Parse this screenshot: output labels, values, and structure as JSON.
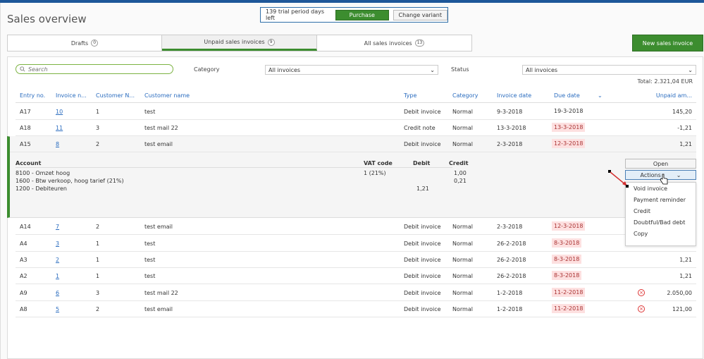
{
  "page": {
    "title": "Sales overview"
  },
  "trial": {
    "text": "139 trial period days left",
    "purchase": "Purchase",
    "change_variant": "Change variant"
  },
  "tabs": [
    {
      "label": "Drafts",
      "count": "0"
    },
    {
      "label": "Unpaid sales invoices",
      "count": "9"
    },
    {
      "label": "All sales invoices",
      "count": "13"
    }
  ],
  "new_button": "New sales invoice",
  "filters": {
    "search_placeholder": "Search",
    "category_label": "Category",
    "category_value": "All invoices",
    "status_label": "Status",
    "status_value": "All invoices"
  },
  "total": "Total: 2.321,04 EUR",
  "columns": {
    "entry": "Entry no.",
    "invoice": "Invoice n...",
    "custno": "Customer N...",
    "custname": "Customer name",
    "type": "Type",
    "category": "Category",
    "invdate": "Invoice date",
    "duedate": "Due date",
    "unpaid": "Unpaid am..."
  },
  "rows": [
    {
      "entry": "A17",
      "invoice": "10",
      "custno": "1",
      "custname": "test",
      "type": "Debit invoice",
      "category": "Normal",
      "invdate": "9-3-2018",
      "duedate": "19-3-2018",
      "late": false,
      "unpaid": "145,20"
    },
    {
      "entry": "A18",
      "invoice": "11",
      "custno": "3",
      "custname": "test mail 22",
      "type": "Credit note",
      "category": "Normal",
      "invdate": "13-3-2018",
      "duedate": "13-3-2018",
      "late": true,
      "unpaid": "-1,21"
    },
    {
      "entry": "A15",
      "invoice": "8",
      "custno": "2",
      "custname": "test email",
      "type": "Debit invoice",
      "category": "Normal",
      "invdate": "2-3-2018",
      "duedate": "12-3-2018",
      "late": true,
      "unpaid": "1,21"
    },
    {
      "entry": "A14",
      "invoice": "7",
      "custno": "2",
      "custname": "test email",
      "type": "Debit invoice",
      "category": "Normal",
      "invdate": "2-3-2018",
      "duedate": "12-3-2018",
      "late": true,
      "unpaid": ""
    },
    {
      "entry": "A4",
      "invoice": "3",
      "custno": "1",
      "custname": "test",
      "type": "Debit invoice",
      "category": "Normal",
      "invdate": "26-2-2018",
      "duedate": "8-3-2018",
      "late": true,
      "unpaid": ""
    },
    {
      "entry": "A3",
      "invoice": "2",
      "custno": "1",
      "custname": "test",
      "type": "Debit invoice",
      "category": "Normal",
      "invdate": "26-2-2018",
      "duedate": "8-3-2018",
      "late": true,
      "unpaid": "1,21"
    },
    {
      "entry": "A2",
      "invoice": "1",
      "custno": "1",
      "custname": "test",
      "type": "Debit invoice",
      "category": "Normal",
      "invdate": "26-2-2018",
      "duedate": "8-3-2018",
      "late": true,
      "unpaid": "1,21"
    },
    {
      "entry": "A9",
      "invoice": "6",
      "custno": "3",
      "custname": "test mail 22",
      "type": "Debit invoice",
      "category": "Normal",
      "invdate": "1-2-2018",
      "duedate": "11-2-2018",
      "late": true,
      "unpaid": "2.050,00",
      "error": true
    },
    {
      "entry": "A8",
      "invoice": "5",
      "custno": "2",
      "custname": "test email",
      "type": "Debit invoice",
      "category": "Normal",
      "invdate": "1-2-2018",
      "duedate": "11-2-2018",
      "late": true,
      "unpaid": "121,00",
      "error": true
    }
  ],
  "detail": {
    "headers": {
      "account": "Account",
      "vat": "VAT code",
      "debit": "Debit",
      "credit": "Credit"
    },
    "lines": [
      {
        "account": "8100 - Omzet hoog",
        "vat": "1 (21%)",
        "debit": "",
        "credit": "1,00"
      },
      {
        "account": "1600 - Btw verkoop, hoog tarief (21%)",
        "vat": "",
        "debit": "",
        "credit": "0,21"
      },
      {
        "account": "1200 - Debiteuren",
        "vat": "",
        "debit": "1,21",
        "credit": ""
      }
    ],
    "open": "Open",
    "actions": "Actions",
    "menu": [
      "Void invoice",
      "Payment reminder",
      "Credit",
      "Doubtful/Bad debt",
      "Copy"
    ]
  },
  "colors": {
    "accent": "#3c8d2f",
    "link": "#2a6cbf",
    "late_bg": "#fde0e0"
  }
}
